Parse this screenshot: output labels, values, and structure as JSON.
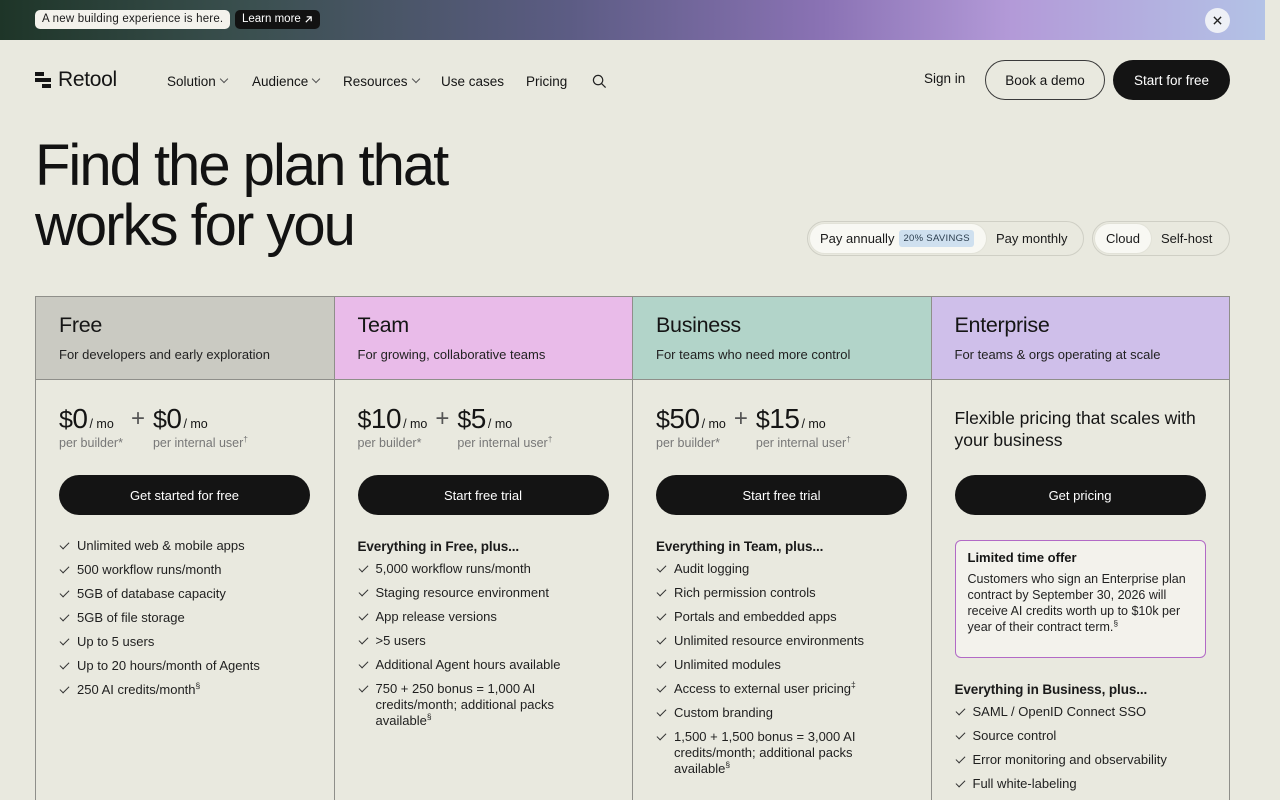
{
  "banner": {
    "message": "A new building experience is here.",
    "link_label": "Learn more",
    "link_icon": "arrow-up-right-icon",
    "close_icon": "close-icon"
  },
  "nav": {
    "logo_text": "Retool",
    "items": [
      {
        "label": "Solution",
        "has_dropdown": true
      },
      {
        "label": "Audience",
        "has_dropdown": true
      },
      {
        "label": "Resources",
        "has_dropdown": true
      },
      {
        "label": "Use cases",
        "has_dropdown": false
      },
      {
        "label": "Pricing",
        "has_dropdown": false
      }
    ],
    "search_icon": "search-icon",
    "sign_in": "Sign in",
    "book_demo": "Book a demo",
    "start_free": "Start for free"
  },
  "hero": {
    "title_line1": "Find the plan that",
    "title_line2": "works for you"
  },
  "billing_toggle": {
    "annual": "Pay annually",
    "savings_badge": "20% SAVINGS",
    "monthly": "Pay monthly",
    "selected": "annual"
  },
  "hosting_toggle": {
    "cloud": "Cloud",
    "self_host": "Self-host",
    "selected": "cloud"
  },
  "colors": {
    "free": "#cacac2",
    "team": "#e9bbe9",
    "business": "#b2d4c9",
    "enterprise": "#cfbfea"
  },
  "plans": {
    "free": {
      "name": "Free",
      "subtitle": "For developers and early exploration",
      "builder_price": "0",
      "user_price": "0",
      "currency": "$",
      "unit": "/ mo",
      "builder_label": "per builder*",
      "user_label": "per internal user",
      "user_mark": "†",
      "cta": "Get started for free",
      "features": [
        {
          "text": "Unlimited web & mobile apps"
        },
        {
          "text": "500 workflow runs/month"
        },
        {
          "text": "5GB of database capacity"
        },
        {
          "text": "5GB of file storage"
        },
        {
          "text": "Up to 5 users"
        },
        {
          "text": "Up to 20 hours/month of Agents"
        },
        {
          "text": "250 AI credits/month",
          "mark": "§"
        }
      ]
    },
    "team": {
      "name": "Team",
      "subtitle": "For growing, collaborative teams",
      "builder_price": "10",
      "user_price": "5",
      "currency": "$",
      "unit": "/ mo",
      "builder_label": "per builder*",
      "user_label": "per internal user",
      "user_mark": "†",
      "cta": "Start free trial",
      "features_heading": "Everything in Free, plus...",
      "features": [
        {
          "text": "5,000 workflow runs/month"
        },
        {
          "text": "Staging resource environment"
        },
        {
          "text": "App release versions"
        },
        {
          "text": ">5 users"
        },
        {
          "text": "Additional Agent hours available"
        },
        {
          "text": "750 + 250 bonus = 1,000 AI credits/month; additional packs available",
          "mark": "§"
        }
      ]
    },
    "business": {
      "name": "Business",
      "subtitle": "For teams who need more control",
      "builder_price": "50",
      "user_price": "15",
      "currency": "$",
      "unit": "/ mo",
      "builder_label": "per builder*",
      "user_label": "per internal user",
      "user_mark": "†",
      "cta": "Start free trial",
      "features_heading": "Everything in Team, plus...",
      "features": [
        {
          "text": "Audit logging"
        },
        {
          "text": "Rich permission controls"
        },
        {
          "text": "Portals and embedded apps"
        },
        {
          "text": "Unlimited resource environments"
        },
        {
          "text": "Unlimited modules"
        },
        {
          "text": "Access to external user pricing",
          "mark": "‡"
        },
        {
          "text": "Custom branding"
        },
        {
          "text": "1,500 + 1,500 bonus = 3,000 AI credits/month; additional packs available",
          "mark": "§"
        }
      ]
    },
    "enterprise": {
      "name": "Enterprise",
      "subtitle": "For teams & orgs operating at scale",
      "pricing_text": "Flexible pricing that scales with your business",
      "cta": "Get pricing",
      "offer_title": "Limited time offer",
      "offer_body": "Customers who sign an Enterprise plan contract by September 30, 2026 will receive AI credits worth up to $10k per year of their contract term.",
      "offer_mark": "§",
      "features_heading": "Everything in Business, plus...",
      "features": [
        {
          "text": "SAML / OpenID Connect SSO"
        },
        {
          "text": "Source control"
        },
        {
          "text": "Error monitoring and observability"
        },
        {
          "text": "Full white-labeling"
        }
      ]
    }
  }
}
